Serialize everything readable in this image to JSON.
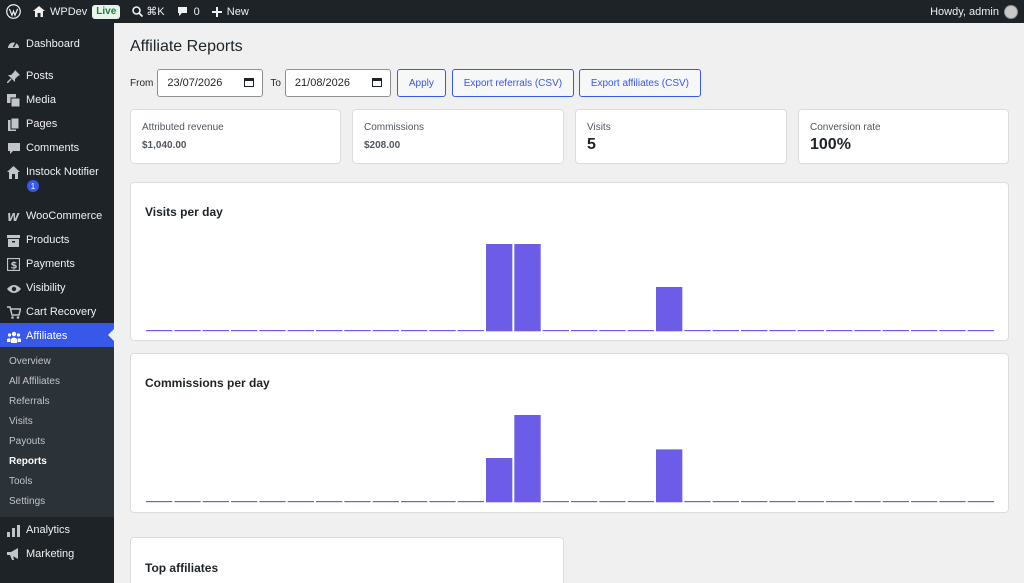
{
  "adminbar": {
    "site_name": "WPDev",
    "live_label": "Live",
    "search_shortcut": "⌘K",
    "comments_count": "0",
    "new_label": "New",
    "greeting": "Howdy, admin"
  },
  "sidebar": {
    "items": [
      {
        "label": "Dashboard",
        "icon": "dashboard-icon"
      },
      {
        "label": "Posts",
        "icon": "pin-icon"
      },
      {
        "label": "Media",
        "icon": "media-icon"
      },
      {
        "label": "Pages",
        "icon": "pages-icon"
      },
      {
        "label": "Comments",
        "icon": "comments-icon"
      },
      {
        "label": "Instock Notifier",
        "icon": "house-icon",
        "badge": "1"
      },
      {
        "label": "WooCommerce",
        "icon": "woo-icon"
      },
      {
        "label": "Products",
        "icon": "archive-icon"
      },
      {
        "label": "Payments",
        "icon": "dollar-icon"
      },
      {
        "label": "Visibility",
        "icon": "eye-icon"
      },
      {
        "label": "Cart Recovery",
        "icon": "cart-icon"
      },
      {
        "label": "Affiliates",
        "icon": "groups-icon"
      },
      {
        "label": "Analytics",
        "icon": "bar-chart-icon"
      },
      {
        "label": "Marketing",
        "icon": "megaphone-icon"
      }
    ],
    "submenu": [
      "Overview",
      "All Affiliates",
      "Referrals",
      "Visits",
      "Payouts",
      "Reports",
      "Tools",
      "Settings"
    ],
    "current_submenu": "Reports"
  },
  "page": {
    "title": "Affiliate Reports",
    "from_label": "From",
    "from_value": "23/07/2026",
    "to_label": "To",
    "to_value": "21/08/2026",
    "apply_label": "Apply",
    "export_referrals_label": "Export referrals (CSV)",
    "export_affiliates_label": "Export affiliates (CSV)"
  },
  "stats": [
    {
      "label": "Attributed revenue",
      "value": "$1,040.00"
    },
    {
      "label": "Commissions",
      "value": "$208.00"
    },
    {
      "label": "Visits",
      "value": "5"
    },
    {
      "label": "Conversion rate",
      "value": "100%"
    }
  ],
  "colors": {
    "accent": "#3858e9",
    "bar": "#6c5ce7",
    "sidebar_bg": "#1d2327"
  },
  "chart_data": [
    {
      "type": "bar",
      "title": "Visits per day",
      "values": [
        0,
        0,
        0,
        0,
        0,
        0,
        0,
        0,
        0,
        0,
        0,
        0,
        2,
        2,
        0,
        0,
        0,
        0,
        1,
        0,
        0,
        0,
        0,
        0,
        0,
        0,
        0,
        0,
        0,
        0
      ],
      "ylim": [
        0,
        2
      ]
    },
    {
      "type": "bar",
      "title": "Commissions per day",
      "values": [
        0,
        0,
        0,
        0,
        0,
        0,
        0,
        0,
        0,
        0,
        0,
        0,
        40,
        80,
        0,
        0,
        0,
        0,
        48,
        0,
        0,
        0,
        0,
        0,
        0,
        0,
        0,
        0,
        0,
        0
      ],
      "ylim": [
        0,
        80
      ]
    }
  ],
  "top_affiliates": {
    "title": "Top affiliates"
  }
}
